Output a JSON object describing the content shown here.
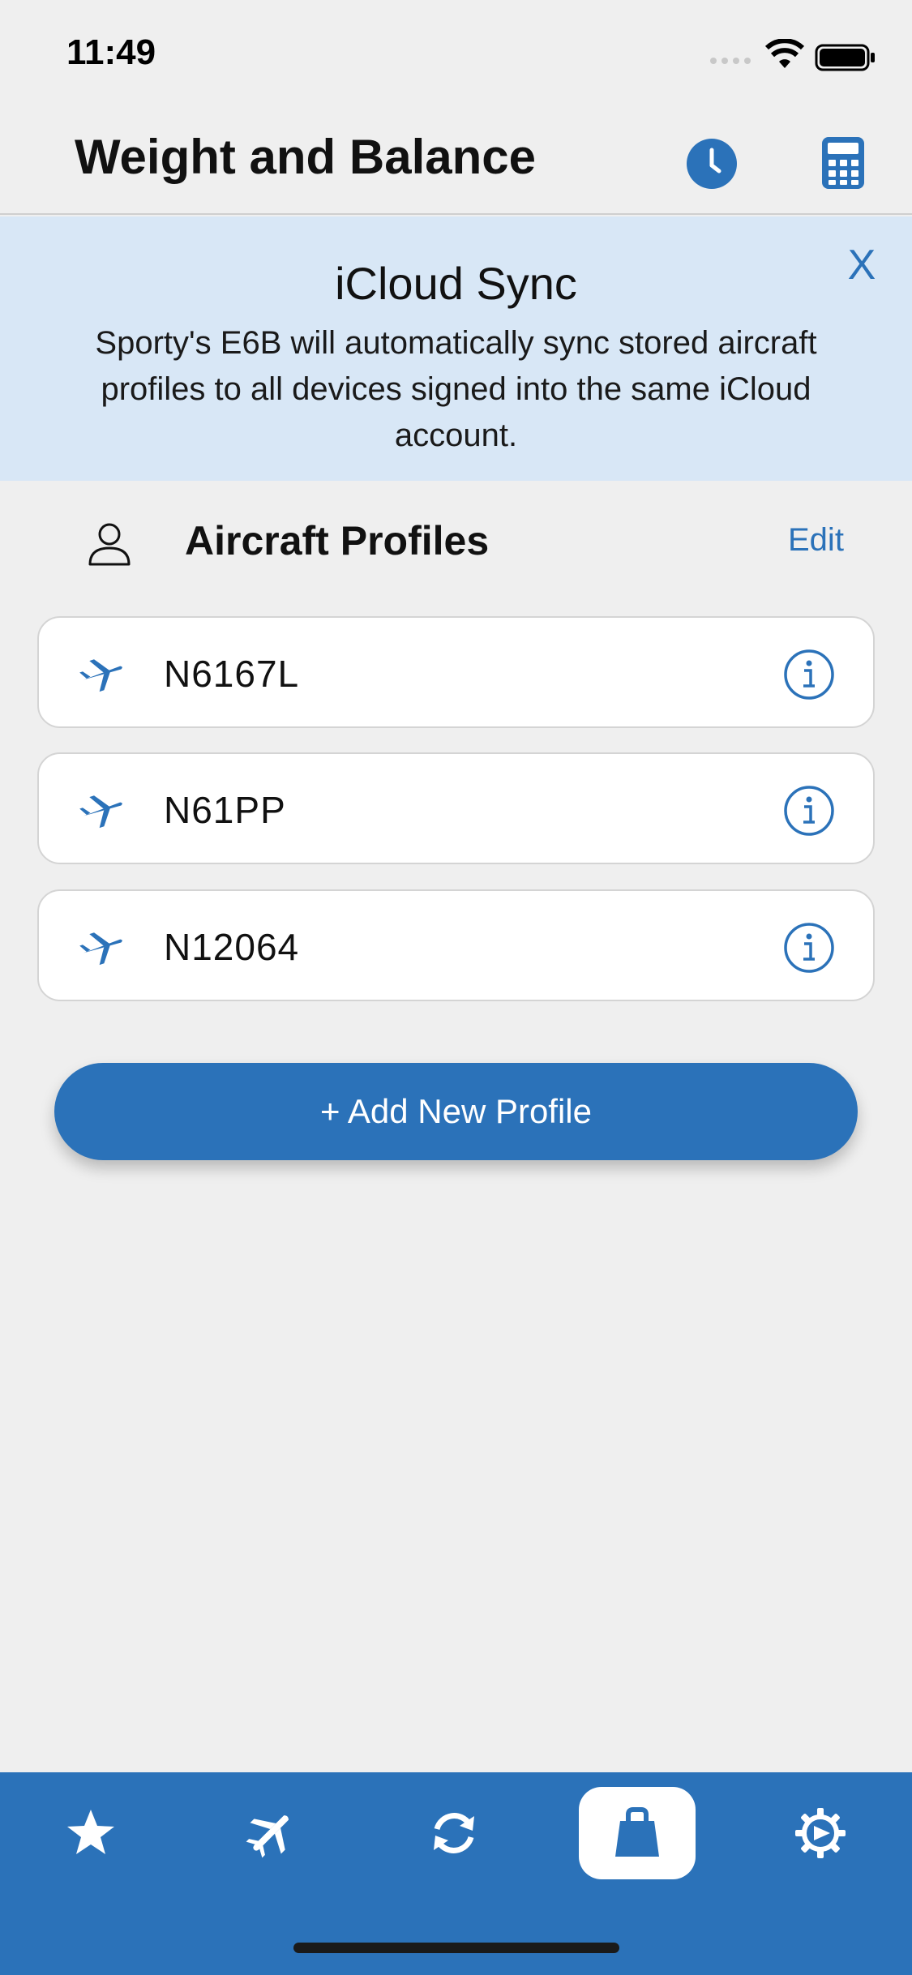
{
  "status_bar": {
    "time": "11:49"
  },
  "header": {
    "title": "Weight and Balance"
  },
  "banner": {
    "title": "iCloud Sync",
    "text": "Sporty's E6B will automatically sync stored aircraft profiles to all devices signed into the same iCloud account.",
    "close_label": "X"
  },
  "profiles_section": {
    "title": "Aircraft Profiles",
    "edit_label": "Edit"
  },
  "profiles": [
    {
      "name": "N6167L"
    },
    {
      "name": "N61PP"
    },
    {
      "name": "N12064"
    }
  ],
  "add_button": {
    "label": "+ Add New Profile"
  },
  "tabs": [
    {
      "icon": "star-icon",
      "active": false
    },
    {
      "icon": "airplane-icon",
      "active": false
    },
    {
      "icon": "sync-icon",
      "active": false
    },
    {
      "icon": "weight-icon",
      "active": true
    },
    {
      "icon": "settings-gear-icon",
      "active": false
    }
  ],
  "colors": {
    "accent": "#2b72b9",
    "banner_bg": "#d8e7f6",
    "page_bg": "#efefef"
  }
}
